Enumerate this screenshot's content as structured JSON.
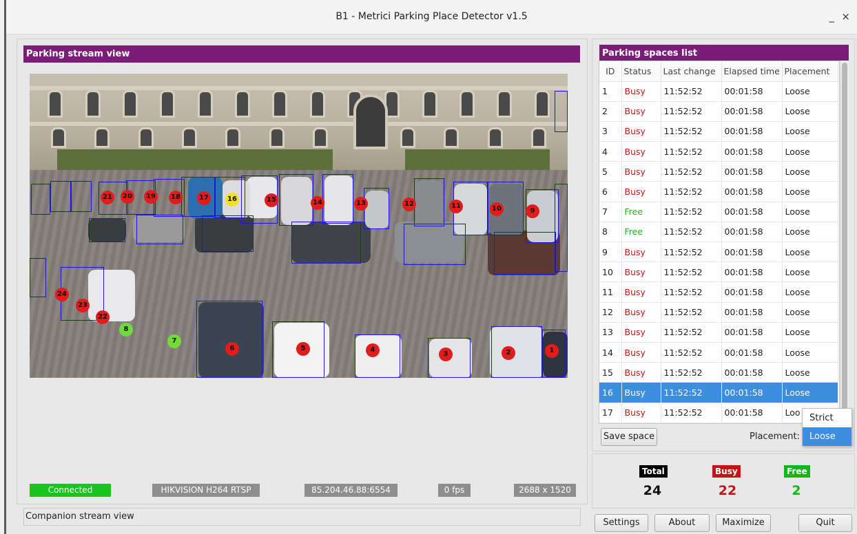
{
  "window": {
    "title": "B1 - Metrici Parking Place Detector v1.5",
    "minimize": "_",
    "close": "×"
  },
  "stream": {
    "header": "Parking stream view",
    "markers": [
      {
        "id": "1",
        "state": "busy"
      },
      {
        "id": "2",
        "state": "busy"
      },
      {
        "id": "3",
        "state": "busy"
      },
      {
        "id": "4",
        "state": "busy"
      },
      {
        "id": "5",
        "state": "busy"
      },
      {
        "id": "6",
        "state": "busy"
      },
      {
        "id": "7",
        "state": "free"
      },
      {
        "id": "8",
        "state": "free"
      },
      {
        "id": "9",
        "state": "busy"
      },
      {
        "id": "10",
        "state": "busy"
      },
      {
        "id": "11",
        "state": "busy"
      },
      {
        "id": "12",
        "state": "busy"
      },
      {
        "id": "13",
        "state": "busy"
      },
      {
        "id": "14",
        "state": "busy"
      },
      {
        "id": "15",
        "state": "busy"
      },
      {
        "id": "16",
        "state": "warn"
      },
      {
        "id": "17",
        "state": "busy"
      },
      {
        "id": "18",
        "state": "busy"
      },
      {
        "id": "19",
        "state": "busy"
      },
      {
        "id": "20",
        "state": "busy"
      },
      {
        "id": "21",
        "state": "busy"
      },
      {
        "id": "22",
        "state": "busy"
      },
      {
        "id": "23",
        "state": "busy"
      },
      {
        "id": "24",
        "state": "busy"
      }
    ],
    "status": {
      "connection": "Connected",
      "codec": "HIKVISION H264 RTSP",
      "address": "85.204.46.88:6554",
      "fps": "0 fps",
      "resolution": "2688 x 1520"
    },
    "companion_label": "Companion stream view"
  },
  "spaces": {
    "header": "Parking spaces list",
    "columns": [
      "ID",
      "Status",
      "Last change",
      "Elapsed time",
      "Placement"
    ],
    "rows": [
      {
        "id": "1",
        "status": "Busy",
        "last_change": "11:52:52",
        "elapsed": "00:01:58",
        "placement": "Loose"
      },
      {
        "id": "2",
        "status": "Busy",
        "last_change": "11:52:52",
        "elapsed": "00:01:58",
        "placement": "Loose"
      },
      {
        "id": "3",
        "status": "Busy",
        "last_change": "11:52:52",
        "elapsed": "00:01:58",
        "placement": "Loose"
      },
      {
        "id": "4",
        "status": "Busy",
        "last_change": "11:52:52",
        "elapsed": "00:01:58",
        "placement": "Loose"
      },
      {
        "id": "5",
        "status": "Busy",
        "last_change": "11:52:52",
        "elapsed": "00:01:58",
        "placement": "Loose"
      },
      {
        "id": "6",
        "status": "Busy",
        "last_change": "11:52:52",
        "elapsed": "00:01:58",
        "placement": "Loose"
      },
      {
        "id": "7",
        "status": "Free",
        "last_change": "11:52:52",
        "elapsed": "00:01:58",
        "placement": "Loose"
      },
      {
        "id": "8",
        "status": "Free",
        "last_change": "11:52:52",
        "elapsed": "00:01:58",
        "placement": "Loose"
      },
      {
        "id": "9",
        "status": "Busy",
        "last_change": "11:52:52",
        "elapsed": "00:01:58",
        "placement": "Loose"
      },
      {
        "id": "10",
        "status": "Busy",
        "last_change": "11:52:52",
        "elapsed": "00:01:58",
        "placement": "Loose"
      },
      {
        "id": "11",
        "status": "Busy",
        "last_change": "11:52:52",
        "elapsed": "00:01:58",
        "placement": "Loose"
      },
      {
        "id": "12",
        "status": "Busy",
        "last_change": "11:52:52",
        "elapsed": "00:01:58",
        "placement": "Loose"
      },
      {
        "id": "13",
        "status": "Busy",
        "last_change": "11:52:52",
        "elapsed": "00:01:58",
        "placement": "Loose"
      },
      {
        "id": "14",
        "status": "Busy",
        "last_change": "11:52:52",
        "elapsed": "00:01:58",
        "placement": "Loose"
      },
      {
        "id": "15",
        "status": "Busy",
        "last_change": "11:52:52",
        "elapsed": "00:01:58",
        "placement": "Loose"
      },
      {
        "id": "16",
        "status": "Busy",
        "last_change": "11:52:52",
        "elapsed": "00:01:58",
        "placement": "Loose",
        "selected": true
      },
      {
        "id": "17",
        "status": "Busy",
        "last_change": "11:52:52",
        "elapsed": "00:01:58",
        "placement": "Loo"
      }
    ],
    "save_button": "Save space",
    "placement_label": "Placement:",
    "placement_options": [
      "Strict",
      "Loose"
    ],
    "placement_selected": "Loose"
  },
  "totals": {
    "total_label": "Total",
    "total_value": "24",
    "busy_label": "Busy",
    "busy_value": "22",
    "free_label": "Free",
    "free_value": "2"
  },
  "buttons": {
    "settings": "Settings",
    "about": "About",
    "maximize": "Maximize",
    "quit": "Quit"
  },
  "colors": {
    "accent": "#7a1c78",
    "busy": "#c21616",
    "free": "#14b814",
    "selection": "#3d8ee0",
    "connected": "#19c41e"
  }
}
